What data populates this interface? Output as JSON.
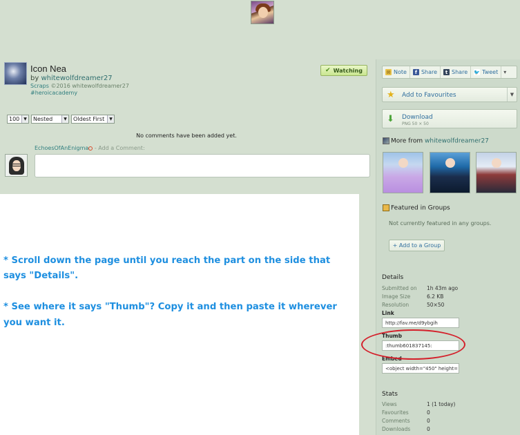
{
  "deviation": {
    "title": "Icon Nea",
    "by_prefix": "by",
    "author": "whitewolfdreamer27",
    "category": "Scraps",
    "copyright": "©2016 whitewolfdreamer27",
    "tag": "#heroicacademy",
    "watch_label": "Watching"
  },
  "comments": {
    "per_page": "100",
    "view_mode": "Nested",
    "sort_order": "Oldest First",
    "empty_message": "No comments have been added yet.",
    "commenter": "EchoesOfAnEnigma",
    "add_comment_label": "- Add a Comment:"
  },
  "tutorial": {
    "line1": "* Scroll down the page until you reach the part on the side that",
    "line2": "says \"Details\".",
    "line3": "* See where it says \"Thumb\"?  Copy it and then paste it wherever",
    "line4": "you want it."
  },
  "share": {
    "note": "Note",
    "facebook": "Share",
    "tumblr": "Share",
    "twitter": "Tweet"
  },
  "actions": {
    "add_favourites": "Add to Favourites",
    "download": "Download",
    "download_info": "PNG 50 × 50"
  },
  "more_from": {
    "label": "More from",
    "user": "whitewolfdreamer27"
  },
  "groups": {
    "title": "Featured in Groups",
    "none": "Not currently featured in any groups.",
    "add_button": "+ Add to a Group"
  },
  "details": {
    "title": "Details",
    "submitted_label": "Submitted on",
    "submitted_value": "1h 43m ago",
    "size_label": "Image Size",
    "size_value": "6.2 KB",
    "res_label": "Resolution",
    "res_value": "50×50",
    "link_label": "Link",
    "link_value": "http://fav.me/d9ybgih",
    "thumb_label": "Thumb",
    "thumb_value": ":thumb601837145:",
    "embed_label": "Embed",
    "embed_value": "<object width=\"450\" height="
  },
  "stats": {
    "title": "Stats",
    "views_label": "Views",
    "views_value": "1 (1 today)",
    "favs_label": "Favourites",
    "favs_value": "0",
    "comments_label": "Comments",
    "comments_value": "0",
    "downloads_label": "Downloads",
    "downloads_value": "0"
  },
  "colors": {
    "page_bg": "#d4dfd0",
    "tutorial_text": "#1e8fe0",
    "highlight_ellipse": "#d41f2a"
  }
}
